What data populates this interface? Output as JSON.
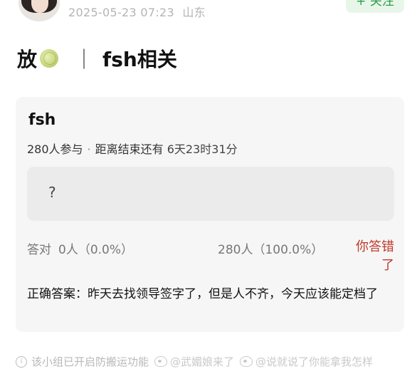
{
  "header": {
    "datetime": "2025-05-23 07:23",
    "location": "山东",
    "follow_label": "+ 关注"
  },
  "post": {
    "title_prefix": "放",
    "title_icon": "melon-icon",
    "separator": "｜",
    "title_suffix": "fsh相关"
  },
  "quiz": {
    "title": "fsh",
    "participants": "280人参与",
    "dot": "·",
    "remaining_label": "距离结束还有",
    "remaining_time": "6天23时31分",
    "question": "?",
    "correct_label": "答对",
    "correct_stat": "0人（0.0%）",
    "wrong_stat": "280人（100.0%）",
    "result_text": "你答错了",
    "answer_text": "正确答案：昨天去找领导签字了，但是人不齐，今天应该能定档了",
    "colors": {
      "wrong": "#c0392b",
      "follow": "#2e9e4a"
    }
  },
  "footer": {
    "notice": "该小组已开启防搬运功能",
    "watermark1": "@武媚娘来了",
    "watermark2": "@说就说了你能拿我怎样"
  }
}
